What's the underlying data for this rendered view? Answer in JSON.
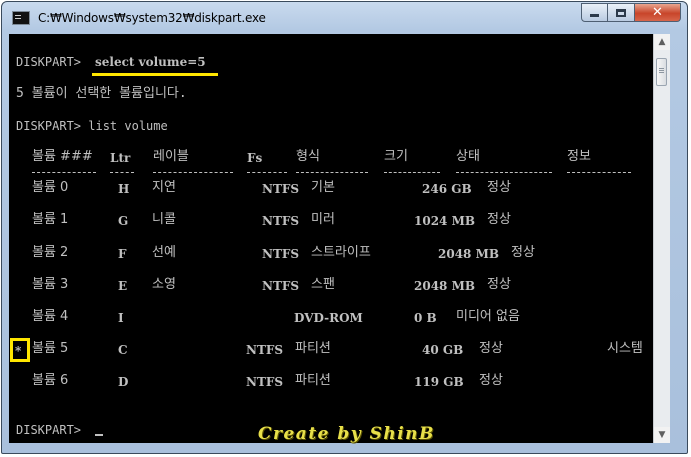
{
  "window": {
    "title": "C:₩Windows₩system32₩diskpart.exe"
  },
  "console": {
    "prompt1": "DISKPART> ",
    "command1": "select volume=5",
    "message": "5 볼륨이 선택한 볼륨입니다.",
    "prompt2": "DISKPART> list volume",
    "prompt3": "DISKPART> ",
    "headers": [
      "볼륨 ###",
      "Ltr",
      "레이블",
      "Fs",
      "형식",
      "크기",
      "상태",
      "정보"
    ],
    "rows": [
      {
        "marker": "",
        "volume": "볼륨 0",
        "ltr": "H",
        "label": "지연",
        "fs": "NTFS",
        "type": "기본",
        "size": "246 GB",
        "status": "정상",
        "info": ""
      },
      {
        "marker": "",
        "volume": "볼륨 1",
        "ltr": "G",
        "label": "니콜",
        "fs": "NTFS",
        "type": "미러",
        "size": "1024 MB",
        "status": "정상",
        "info": ""
      },
      {
        "marker": "",
        "volume": "볼륨 2",
        "ltr": "F",
        "label": "선예",
        "fs": "NTFS",
        "type": "스트라이프",
        "size": "2048 MB",
        "status": "정상",
        "info": ""
      },
      {
        "marker": "",
        "volume": "볼륨 3",
        "ltr": "E",
        "label": "소영",
        "fs": "NTFS",
        "type": "스팬",
        "size": "2048 MB",
        "status": "정상",
        "info": ""
      },
      {
        "marker": "",
        "volume": "볼륨 4",
        "ltr": "I",
        "label": "",
        "fs": "",
        "type": "DVD-ROM",
        "size": "0 B",
        "status": "미디어 없음",
        "info": ""
      },
      {
        "marker": "*",
        "volume": "볼륨 5",
        "ltr": "C",
        "label": "",
        "fs": "NTFS",
        "type": "파티션",
        "size": "40 GB",
        "status": "정상",
        "info": "시스템"
      },
      {
        "marker": "",
        "volume": "볼륨 6",
        "ltr": "D",
        "label": "",
        "fs": "NTFS",
        "type": "파티션",
        "size": "119 GB",
        "status": "정상",
        "info": ""
      }
    ]
  },
  "watermark": "Create by ShinB",
  "colors": {
    "console_bg": "#000000",
    "console_text": "#c0c0c0",
    "highlight": "#ffe600",
    "watermark": "#e8e04a"
  },
  "icons": {
    "app": "console-icon",
    "minimize": "minimize-icon",
    "maximize": "maximize-icon",
    "close": "close-icon"
  }
}
